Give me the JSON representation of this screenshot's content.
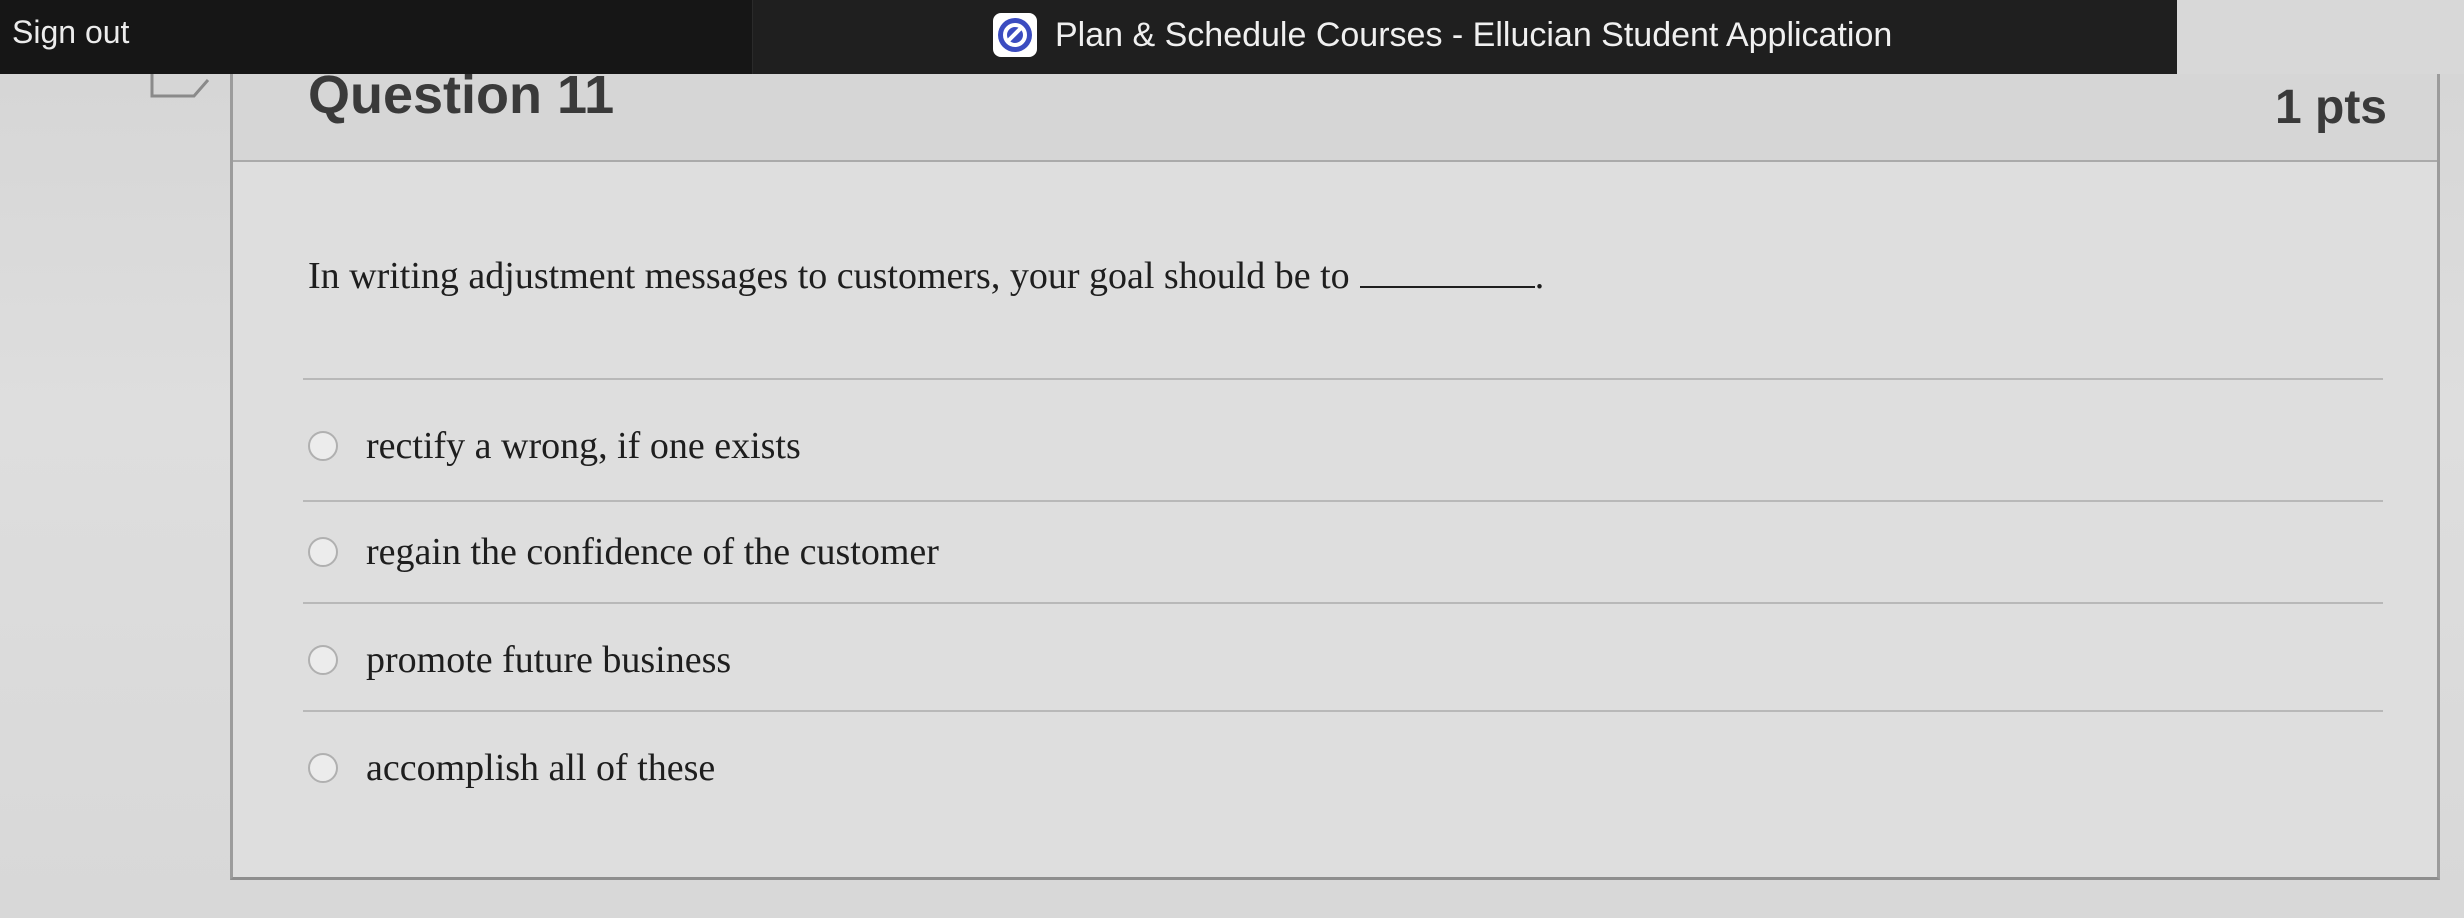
{
  "topbar": {
    "sign_out_label": "Sign out",
    "app_title": "Plan & Schedule Courses - Ellucian Student Application",
    "app_icon": "ellucian-logo-icon"
  },
  "question": {
    "title": "Question 11",
    "points": "1 pts",
    "text": "In writing adjustment messages to customers, your goal should be to",
    "blank_suffix": ".",
    "answers": [
      {
        "label": "rectify a wrong, if one exists",
        "selected": false
      },
      {
        "label": "regain the confidence of the customer",
        "selected": false
      },
      {
        "label": "promote future business",
        "selected": false
      },
      {
        "label": "accomplish all of these",
        "selected": false
      }
    ]
  }
}
